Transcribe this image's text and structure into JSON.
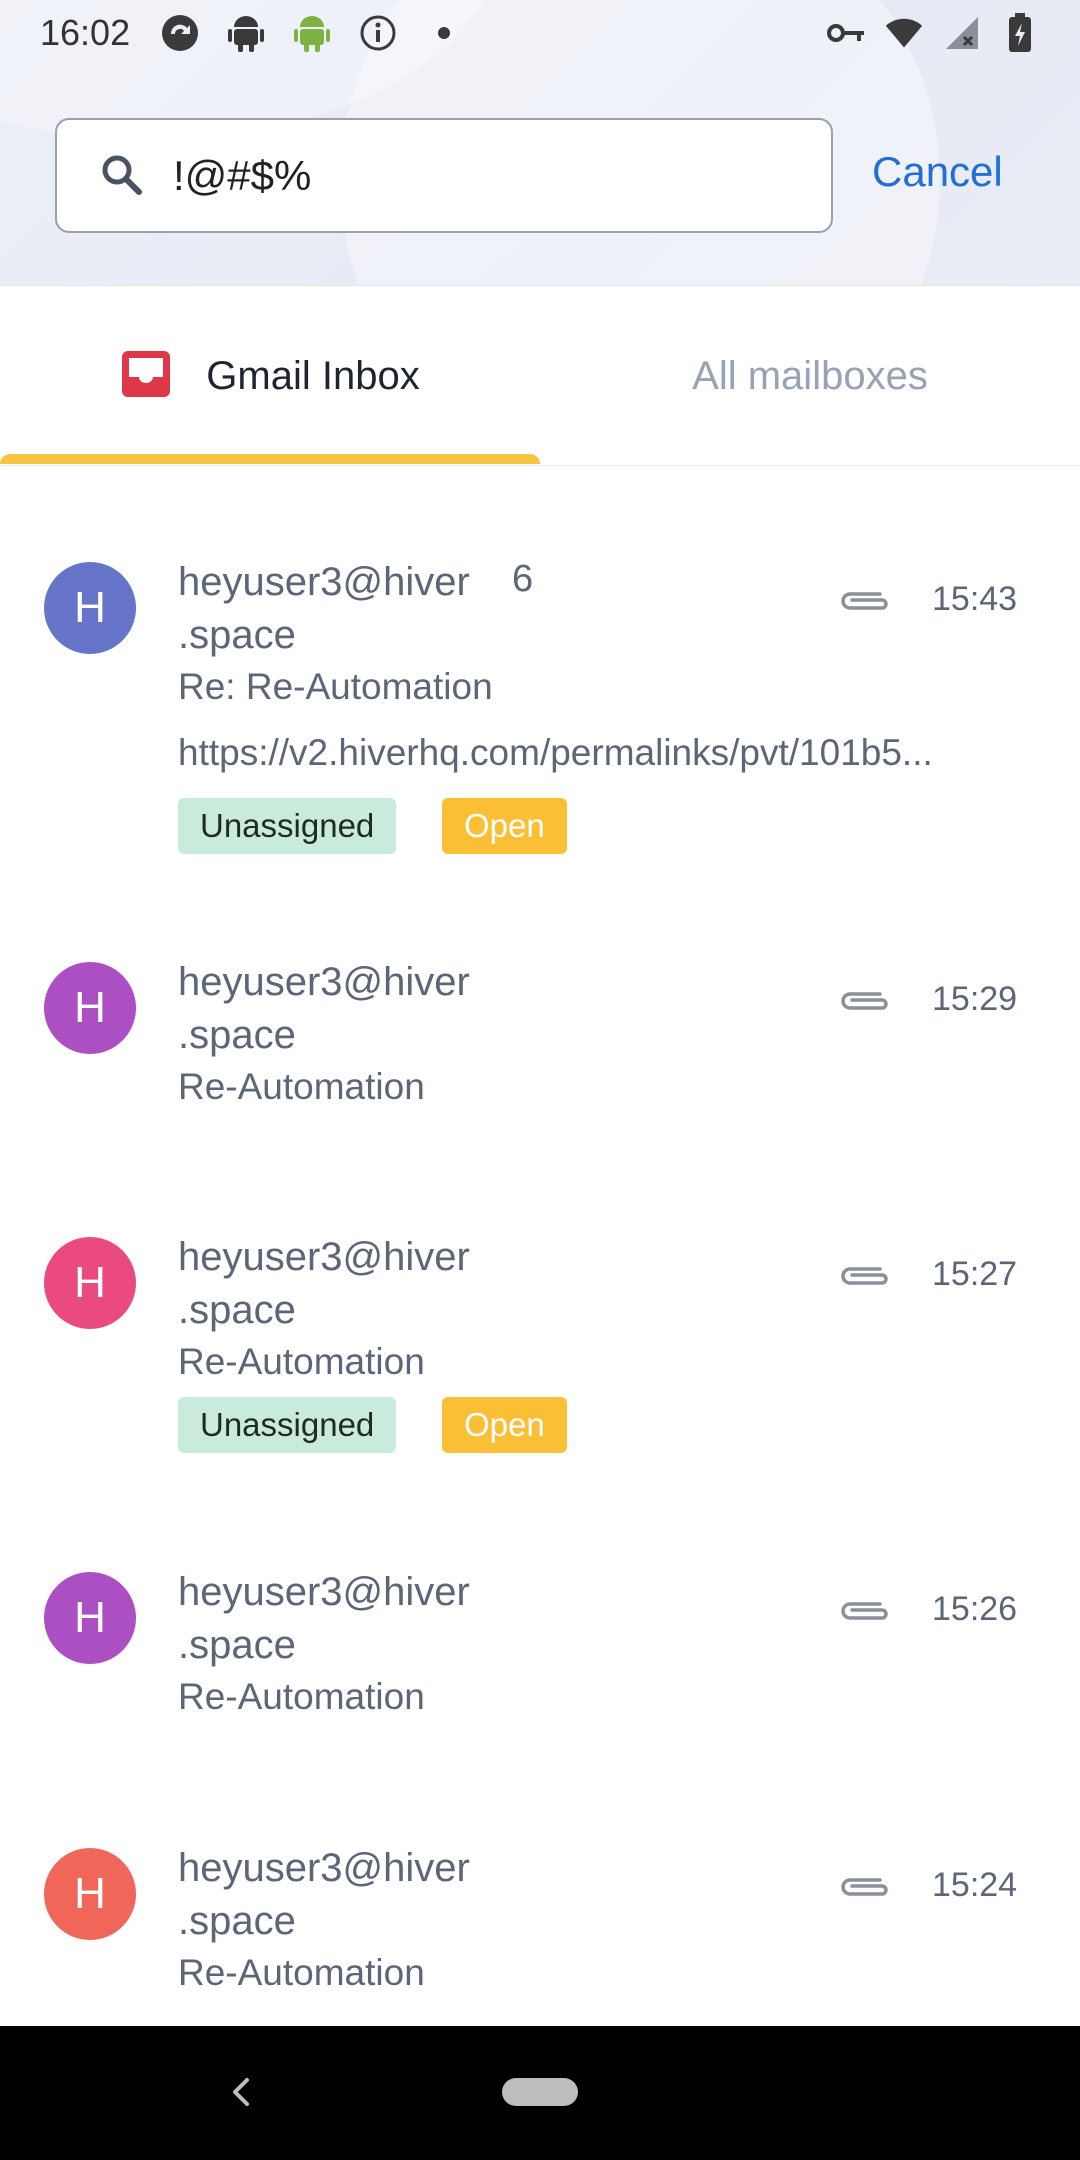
{
  "status_bar": {
    "time": "16:02",
    "left_icons": [
      "sync-icon",
      "android-icon",
      "android-green-icon",
      "info-icon",
      "dot-icon"
    ],
    "right_icons": [
      "key-icon",
      "wifi-icon",
      "signal-icon",
      "battery-icon"
    ]
  },
  "search": {
    "value": "!@#$%",
    "cancel_label": "Cancel"
  },
  "tabs": [
    {
      "label": "Gmail Inbox",
      "active": true,
      "icon": "inbox-icon"
    },
    {
      "label": "All mailboxes",
      "active": false
    }
  ],
  "colors": {
    "accent": "#1f6fd6",
    "tab_indicator": "#f5c542",
    "inbox_icon": "#e0364a",
    "badge_unassigned_bg": "#c9ebdc",
    "badge_open_bg": "#fbbf35"
  },
  "emails": [
    {
      "avatar_letter": "H",
      "avatar_color": "#6674c9",
      "sender_line1": "heyuser3@hiver",
      "sender_line2": ".space",
      "count": "6",
      "time": "15:43",
      "subject": "Re: Re-Automation",
      "preview": "https://v2.hiverhq.com/permalinks/pvt/101b5...",
      "badges": [
        "Unassigned",
        "Open"
      ]
    },
    {
      "avatar_letter": "H",
      "avatar_color": "#ab4fc2",
      "sender_line1": "heyuser3@hiver",
      "sender_line2": ".space",
      "time": "15:29",
      "subject": "Re-Automation"
    },
    {
      "avatar_letter": "H",
      "avatar_color": "#ea4a7f",
      "sender_line1": "heyuser3@hiver",
      "sender_line2": ".space",
      "time": "15:27",
      "subject": "Re-Automation",
      "badges": [
        "Unassigned",
        "Open"
      ]
    },
    {
      "avatar_letter": "H",
      "avatar_color": "#ab4fc2",
      "sender_line1": "heyuser3@hiver",
      "sender_line2": ".space",
      "time": "15:26",
      "subject": "Re-Automation"
    },
    {
      "avatar_letter": "H",
      "avatar_color": "#f0675a",
      "sender_line1": "heyuser3@hiver",
      "sender_line2": ".space",
      "time": "15:24",
      "subject": "Re-Automation"
    }
  ]
}
